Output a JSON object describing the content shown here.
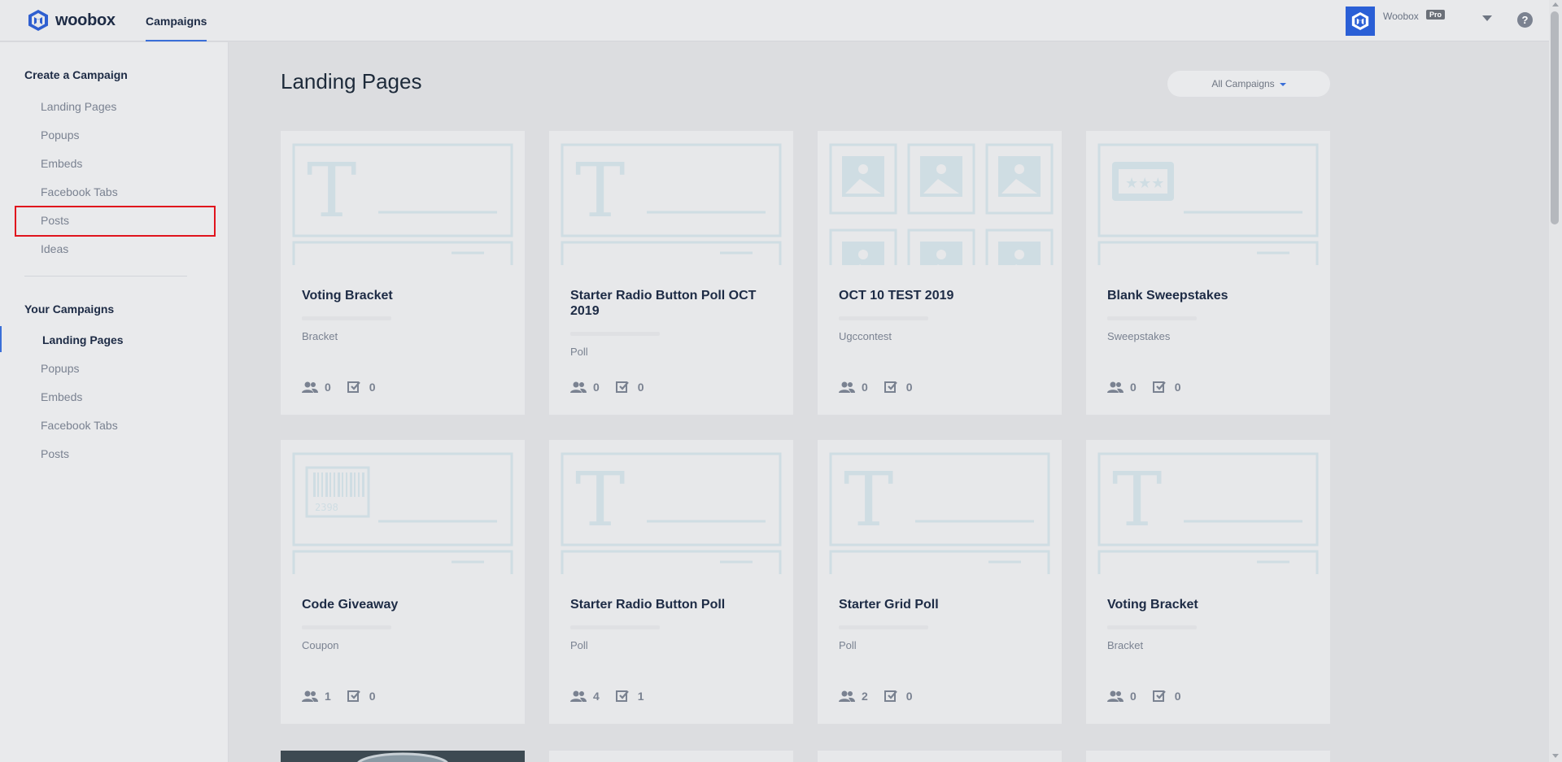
{
  "header": {
    "logo_text": "woobox",
    "nav_tab": "Campaigns",
    "user_name": "Woobox",
    "plan_badge": "Pro",
    "help_label": "?"
  },
  "sidebar": {
    "create_heading": "Create a Campaign",
    "create_items": [
      "Landing Pages",
      "Popups",
      "Embeds",
      "Facebook Tabs",
      "Posts",
      "Ideas"
    ],
    "your_heading": "Your Campaigns",
    "your_items": [
      "Landing Pages",
      "Popups",
      "Embeds",
      "Facebook Tabs",
      "Posts"
    ],
    "active_item": "Landing Pages",
    "highlighted_item": "Posts"
  },
  "main": {
    "title": "Landing Pages",
    "filter_label": "All Campaigns",
    "cards": [
      {
        "title": "Voting Bracket",
        "type": "Bracket",
        "entrants": "0",
        "entries": "0",
        "thumb": "text-template"
      },
      {
        "title": "Starter Radio Button Poll OCT 2019",
        "type": "Poll",
        "entrants": "0",
        "entries": "0",
        "thumb": "text-template"
      },
      {
        "title": "OCT 10 TEST 2019",
        "type": "Ugccontest",
        "entrants": "0",
        "entries": "0",
        "thumb": "image-grid"
      },
      {
        "title": "Blank Sweepstakes",
        "type": "Sweepstakes",
        "entrants": "0",
        "entries": "0",
        "thumb": "ticket-template"
      },
      {
        "title": "Code Giveaway",
        "type": "Coupon",
        "entrants": "1",
        "entries": "0",
        "thumb": "barcode-template"
      },
      {
        "title": "Starter Radio Button Poll",
        "type": "Poll",
        "entrants": "4",
        "entries": "1",
        "thumb": "text-template"
      },
      {
        "title": "Starter Grid Poll",
        "type": "Poll",
        "entrants": "2",
        "entries": "0",
        "thumb": "text-template"
      },
      {
        "title": "Voting Bracket",
        "type": "Bracket",
        "entrants": "0",
        "entries": "0",
        "thumb": "text-template"
      }
    ]
  },
  "colors": {
    "accent": "#3a6fd8",
    "highlight": "#e0141d",
    "heading": "#1d2b45",
    "muted": "#7a8291",
    "thumb_stroke": "#cfdde3"
  }
}
